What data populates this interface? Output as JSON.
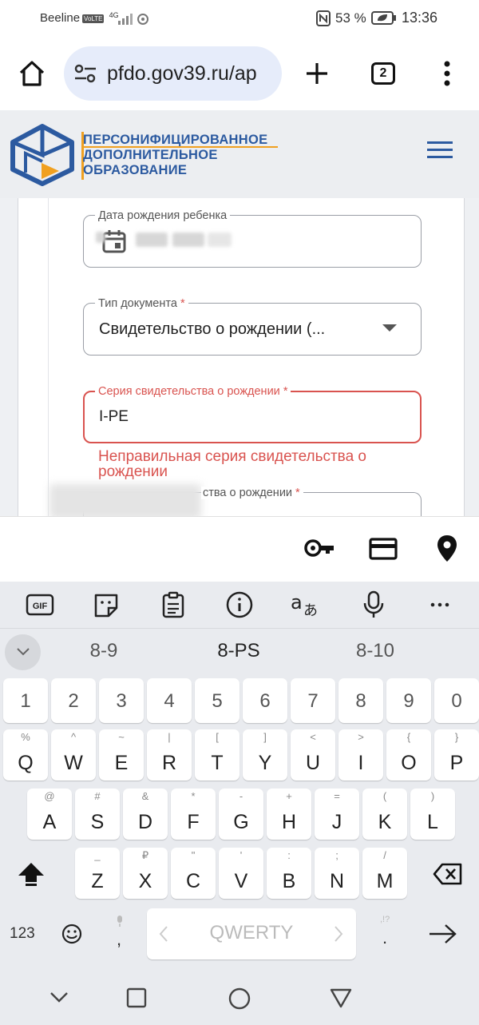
{
  "status_bar": {
    "carrier": "Beeline",
    "volte_badge": "VoLTE",
    "network": "4G",
    "battery_percent": "53 %",
    "time": "13:36"
  },
  "browser": {
    "url": "pfdo.gov39.ru/ap",
    "tab_count": "2"
  },
  "site": {
    "logo_lines": [
      "ПЕРСОНИФИЦИРОВАННОЕ",
      "ДОПОЛНИТЕЛЬНОЕ",
      "ОБРАЗОВАНИЕ"
    ]
  },
  "form": {
    "birth_date": {
      "label": "Дата рождения ребенка"
    },
    "doc_type": {
      "label": "Тип документа",
      "required_mark": "*",
      "value": "Свидетельство о рождении (..."
    },
    "series": {
      "label": "Серия свидетельства о рождении",
      "required_mark": "*",
      "value": "I-PE",
      "error": "Неправильная серия свидетельства о рождении"
    },
    "number": {
      "label": "ства о рождении",
      "required_mark": "*"
    }
  },
  "keyboard": {
    "suggestions": [
      "8-9",
      "8-PS",
      "8-10"
    ],
    "number_row": [
      "1",
      "2",
      "3",
      "4",
      "5",
      "6",
      "7",
      "8",
      "9",
      "0"
    ],
    "row1": [
      {
        "main": "Q",
        "alt": "%"
      },
      {
        "main": "W",
        "alt": "^"
      },
      {
        "main": "E",
        "alt": "~"
      },
      {
        "main": "R",
        "alt": "|"
      },
      {
        "main": "T",
        "alt": "["
      },
      {
        "main": "Y",
        "alt": "]"
      },
      {
        "main": "U",
        "alt": "<"
      },
      {
        "main": "I",
        "alt": ">"
      },
      {
        "main": "O",
        "alt": "{"
      },
      {
        "main": "P",
        "alt": "}"
      }
    ],
    "row2": [
      {
        "main": "A",
        "alt": "@"
      },
      {
        "main": "S",
        "alt": "#"
      },
      {
        "main": "D",
        "alt": "&"
      },
      {
        "main": "F",
        "alt": "*"
      },
      {
        "main": "G",
        "alt": "-"
      },
      {
        "main": "H",
        "alt": "+"
      },
      {
        "main": "J",
        "alt": "="
      },
      {
        "main": "K",
        "alt": "("
      },
      {
        "main": "L",
        "alt": ")"
      }
    ],
    "row3": [
      {
        "main": "Z",
        "alt": "_"
      },
      {
        "main": "X",
        "alt": "₽"
      },
      {
        "main": "C",
        "alt": "\""
      },
      {
        "main": "V",
        "alt": "'"
      },
      {
        "main": "B",
        "alt": ":"
      },
      {
        "main": "N",
        "alt": ";"
      },
      {
        "main": "M",
        "alt": "/"
      }
    ],
    "mode_key": "123",
    "comma": ",",
    "space_label": "QWERTY",
    "period": ".",
    "period_alt": ",!?"
  },
  "colors": {
    "brand_blue": "#2c5aa0",
    "brand_orange": "#f0a020",
    "error_red": "#d9534f",
    "url_pill": "#e6ecfa"
  },
  "icons": {
    "browser": [
      "home-icon",
      "site-settings-icon",
      "new-tab-icon",
      "tabs-icon",
      "more-vert-icon"
    ],
    "autofill": [
      "key-icon",
      "credit-card-icon",
      "location-pin-icon"
    ],
    "keyboard_toolbar": [
      "gif-icon",
      "sticker-icon",
      "clipboard-icon",
      "info-icon",
      "translate-icon",
      "microphone-icon",
      "more-horiz-icon"
    ],
    "nav": [
      "back-icon",
      "home-nav-icon",
      "recents-icon"
    ]
  }
}
